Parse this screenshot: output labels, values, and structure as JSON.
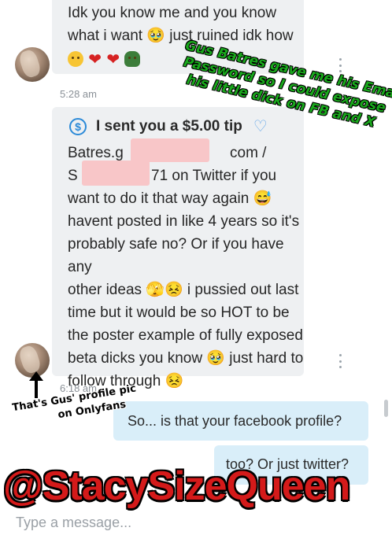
{
  "messages": [
    {
      "lines": [
        "Idk you know me and you know",
        "what i want 🥹 just ruined idk how"
      ],
      "emoji_row": [
        "pleading-face",
        "red-heart",
        "red-heart",
        "person-gesturing-no"
      ],
      "time": "5:28 am"
    },
    {
      "tip_label": "I sent you a $5.00 tip",
      "lines": [
        "Batres.g",
        "com /",
        "S",
        "71 on Twitter if you",
        "want to do it that way again 😅",
        "havent posted in like 4 years so it's",
        "probably safe no? Or if you have any",
        "other ideas 🫣😣 i pussied out last",
        "time but it would be so HOT to be",
        "the poster example of fully exposed",
        "beta dicks you know 🥹 just hard to",
        "follow through 😣"
      ],
      "time": "6:18 am"
    }
  ],
  "sent": [
    {
      "text": "So... is that your facebook profile?"
    },
    {
      "text": "too? Or just twitter?"
    }
  ],
  "overlays": {
    "green_lines": [
      "Gus Batres gave me his Email &",
      "Password so I could expose",
      "his little dick on FB and X"
    ],
    "black_lines": [
      "That's Gus' profile pic",
      "on Onlyfans"
    ],
    "watermark": "@StacySizeQueen"
  },
  "composer": {
    "placeholder": "Type a message..."
  },
  "icons": {
    "tip": "dollar-circle-icon",
    "tip_heart": "heart-outline-icon",
    "menu": "kebab-menu-icon"
  },
  "colors": {
    "received_bubble": "#eef0f2",
    "sent_bubble": "#d9eef9",
    "tip_accent": "#2b8ad8",
    "overlay_green": "#19a81c",
    "watermark_red": "#d41a1a",
    "redaction_pink": "#f8c6c8"
  }
}
